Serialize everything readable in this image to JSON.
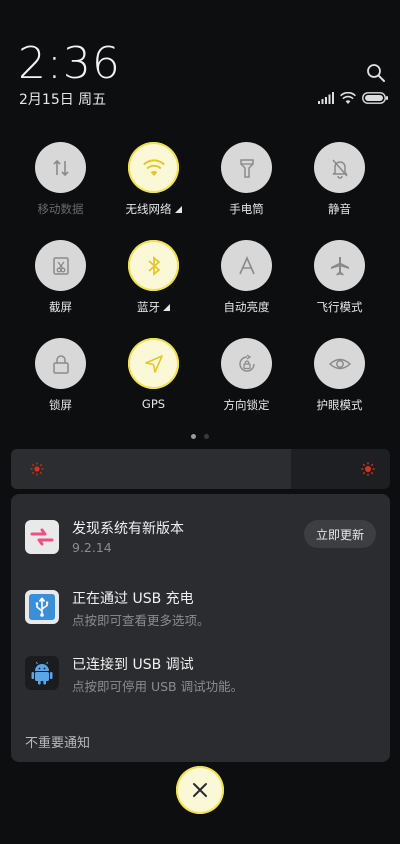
{
  "header": {
    "time": "2:36",
    "date": "2月15日 周五"
  },
  "tiles": [
    {
      "label": "移动数据",
      "icon": "mobile-data-icon",
      "active": false,
      "dim": true
    },
    {
      "label": "无线网络",
      "icon": "wifi-icon",
      "active": true,
      "has_more": true
    },
    {
      "label": "手电筒",
      "icon": "flashlight-icon",
      "active": false
    },
    {
      "label": "静音",
      "icon": "mute-bell-icon",
      "active": false
    },
    {
      "label": "截屏",
      "icon": "screenshot-icon",
      "active": false
    },
    {
      "label": "蓝牙",
      "icon": "bluetooth-icon",
      "active": true,
      "has_more": true
    },
    {
      "label": "自动亮度",
      "icon": "auto-brightness-icon",
      "active": false
    },
    {
      "label": "飞行模式",
      "icon": "airplane-icon",
      "active": false
    },
    {
      "label": "锁屏",
      "icon": "lock-icon",
      "active": false
    },
    {
      "label": "GPS",
      "icon": "gps-icon",
      "active": true
    },
    {
      "label": "方向锁定",
      "icon": "rotation-lock-icon",
      "active": false
    },
    {
      "label": "护眼模式",
      "icon": "eye-icon",
      "active": false
    }
  ],
  "brightness": {
    "level": 0.74
  },
  "notifications": [
    {
      "title": "发现系统有新版本",
      "subtitle": "9.2.14",
      "icon": "update-icon",
      "action": "立即更新"
    },
    {
      "title": "正在通过  USB  充电",
      "subtitle": "点按即可查看更多选项。",
      "icon": "usb-icon"
    },
    {
      "title": "已连接到  USB  调试",
      "subtitle": "点按即可停用 USB 调试功能。",
      "icon": "android-icon"
    }
  ],
  "footer": {
    "label": "不重要通知"
  },
  "colors": {
    "accent": "#f2e14a",
    "tile_bg": "#d8d8d8",
    "panel_bg": "#2a2c2f"
  }
}
